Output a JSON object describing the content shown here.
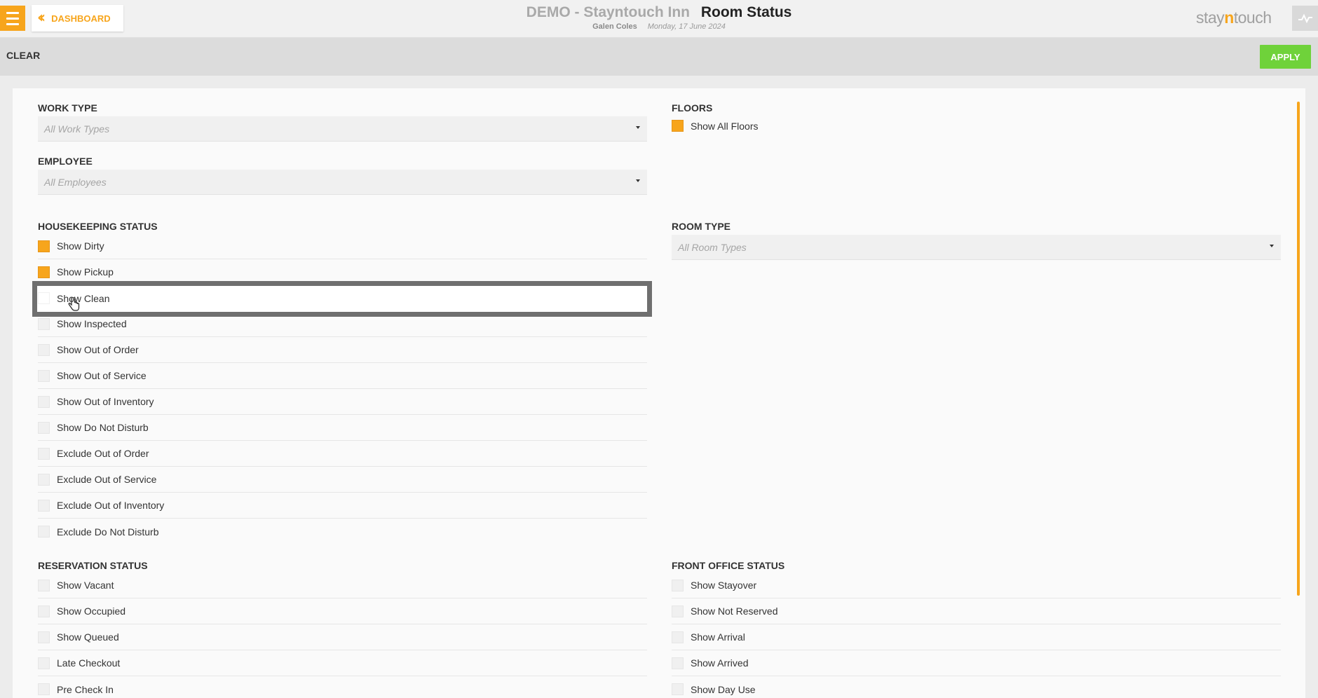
{
  "header": {
    "dashboard_label": "DASHBOARD",
    "hotel_name": "DEMO - Stayntouch Inn",
    "page_title": "Room Status",
    "user_name": "Galen Coles",
    "date": "Monday, 17 June 2024",
    "logo_pre": "stay",
    "logo_n": "n",
    "logo_post": "touch"
  },
  "toolbar": {
    "clear_label": "CLEAR",
    "apply_label": "APPLY"
  },
  "work_type": {
    "title": "WORK TYPE",
    "placeholder": "All Work Types"
  },
  "employee": {
    "title": "EMPLOYEE",
    "placeholder": "All Employees"
  },
  "floors": {
    "title": "FLOORS",
    "options": [
      {
        "label": "Show All Floors",
        "checked": true
      }
    ]
  },
  "room_type": {
    "title": "ROOM TYPE",
    "placeholder": "All Room Types"
  },
  "housekeeping": {
    "title": "HOUSEKEEPING STATUS",
    "options": [
      {
        "label": "Show Dirty",
        "checked": true
      },
      {
        "label": "Show Pickup",
        "checked": true
      },
      {
        "label": "Show Clean",
        "checked": false
      },
      {
        "label": "Show Inspected",
        "checked": false
      },
      {
        "label": "Show Out of Order",
        "checked": false
      },
      {
        "label": "Show Out of Service",
        "checked": false
      },
      {
        "label": "Show Out of Inventory",
        "checked": false
      },
      {
        "label": "Show Do Not Disturb",
        "checked": false
      },
      {
        "label": "Exclude Out of Order",
        "checked": false
      },
      {
        "label": "Exclude Out of Service",
        "checked": false
      },
      {
        "label": "Exclude Out of Inventory",
        "checked": false
      },
      {
        "label": "Exclude Do Not Disturb",
        "checked": false
      }
    ]
  },
  "reservation": {
    "title": "RESERVATION STATUS",
    "options": [
      {
        "label": "Show Vacant",
        "checked": false
      },
      {
        "label": "Show Occupied",
        "checked": false
      },
      {
        "label": "Show Queued",
        "checked": false
      },
      {
        "label": "Late Checkout",
        "checked": false
      },
      {
        "label": "Pre Check In",
        "checked": false
      }
    ]
  },
  "front_office": {
    "title": "FRONT OFFICE STATUS",
    "options": [
      {
        "label": "Show Stayover",
        "checked": false
      },
      {
        "label": "Show Not Reserved",
        "checked": false
      },
      {
        "label": "Show Arrival",
        "checked": false
      },
      {
        "label": "Show Arrived",
        "checked": false
      },
      {
        "label": "Show Day Use",
        "checked": false
      }
    ]
  },
  "colors": {
    "accent": "#f7a51c",
    "apply": "#6fd23a"
  }
}
